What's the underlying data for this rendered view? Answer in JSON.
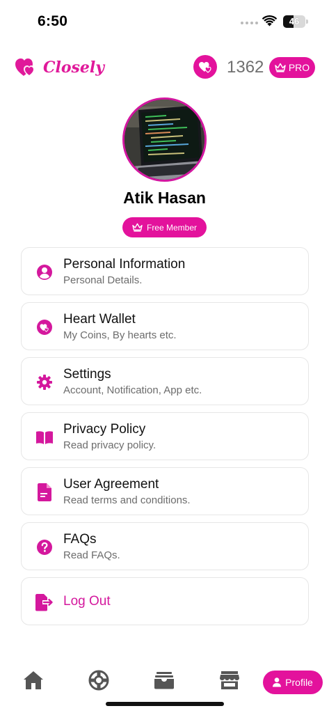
{
  "status_bar": {
    "time": "6:50",
    "battery": "46"
  },
  "header": {
    "app_name": "Closely",
    "coins": "1362",
    "pro_label": "PRO"
  },
  "profile": {
    "name": "Atik Hasan",
    "membership": "Free Member"
  },
  "menu": [
    {
      "title": "Personal Information",
      "subtitle": "Personal Details.",
      "icon": "user-circle-icon"
    },
    {
      "title": "Heart Wallet",
      "subtitle": "My Coins, By hearts etc.",
      "icon": "heart-coin-icon"
    },
    {
      "title": "Settings",
      "subtitle": "Account, Notification, App etc.",
      "icon": "gear-icon"
    },
    {
      "title": "Privacy Policy",
      "subtitle": "Read privacy policy.",
      "icon": "book-icon"
    },
    {
      "title": "User Agreement",
      "subtitle": "Read terms and conditions.",
      "icon": "document-icon"
    },
    {
      "title": "FAQs",
      "subtitle": "Read FAQs.",
      "icon": "question-icon"
    }
  ],
  "logout": {
    "label": "Log Out",
    "icon": "logout-icon"
  },
  "bottom_nav": {
    "items": [
      "home-icon",
      "lifebuoy-icon",
      "wallet-icon",
      "store-icon"
    ],
    "active_label": "Profile"
  },
  "colors": {
    "accent": "#e3129c",
    "text_gray": "#6c6c6c",
    "border": "#e6e6e6"
  }
}
